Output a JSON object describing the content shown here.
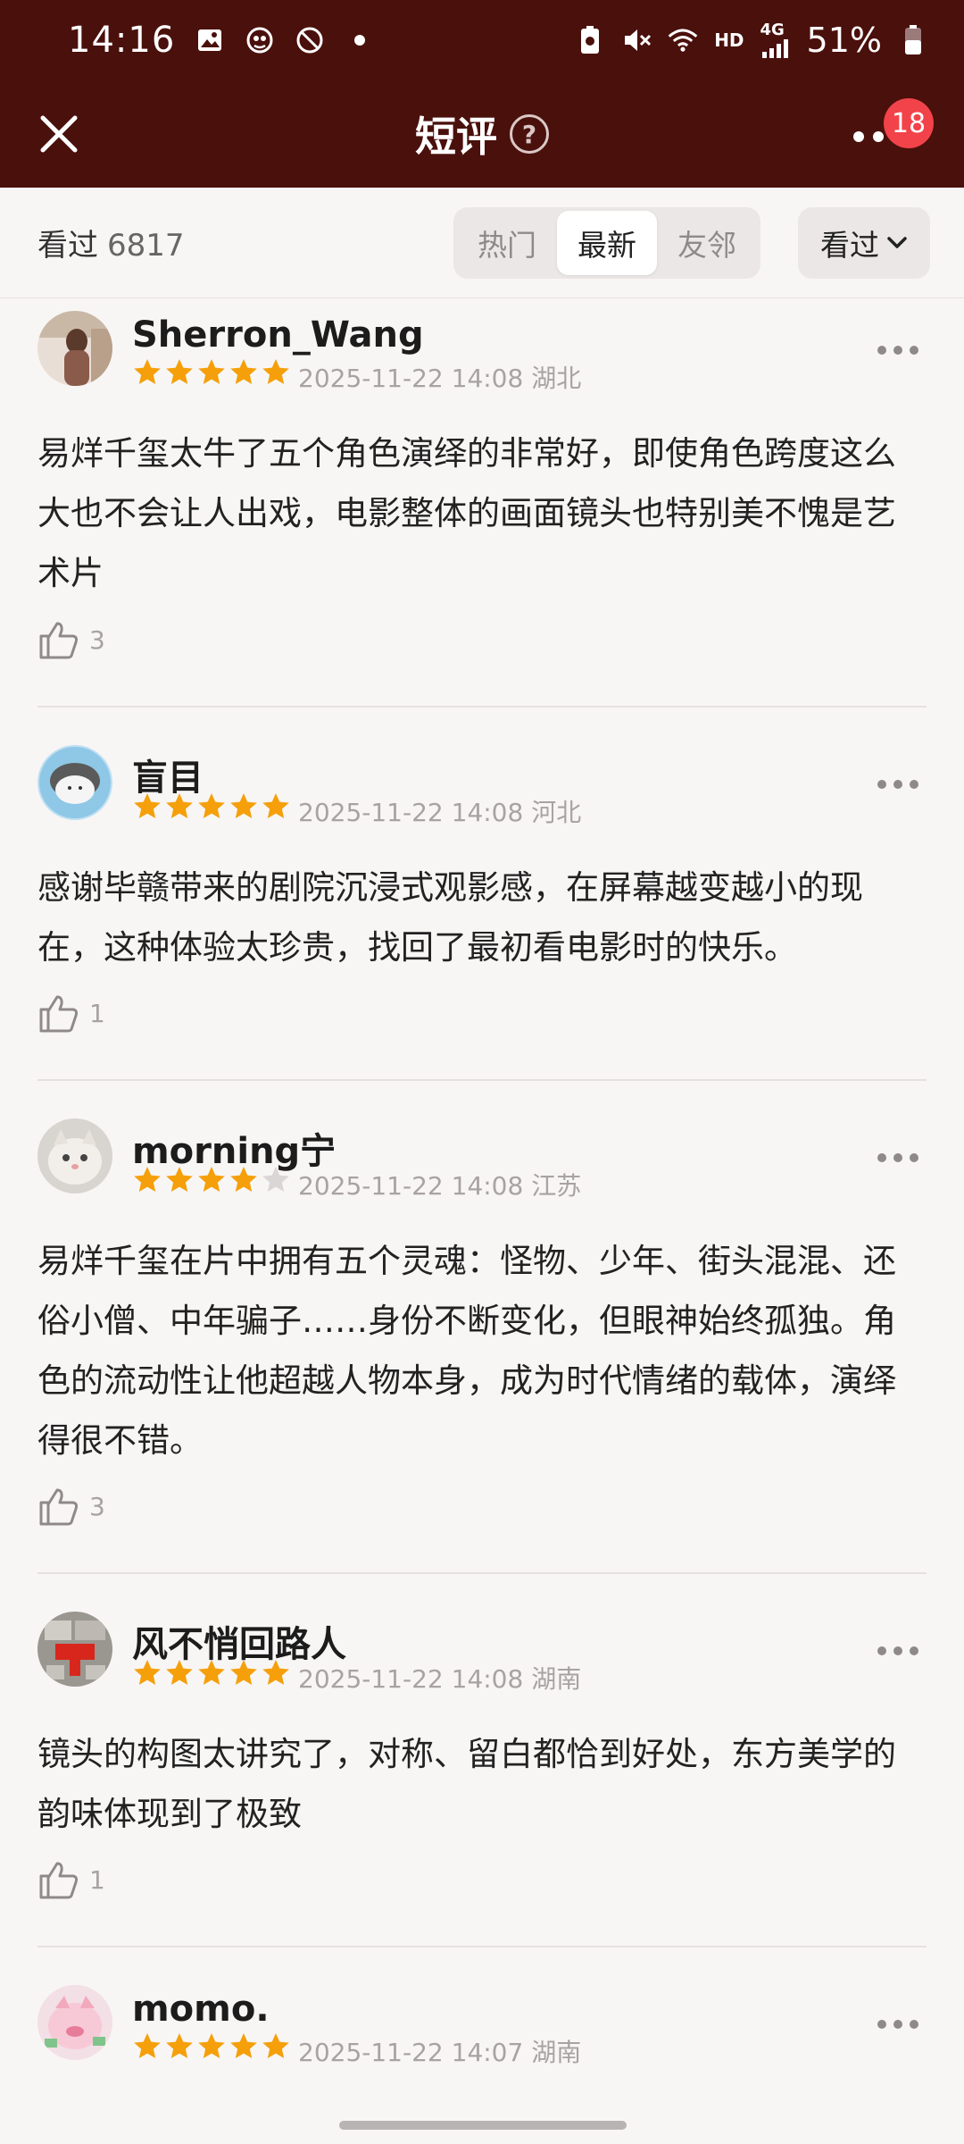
{
  "status_bar": {
    "time": "14:16",
    "network": "HD",
    "signal": "4G",
    "battery": "51%"
  },
  "header": {
    "title": "短评",
    "help": "?",
    "badge": "18",
    "icons": [
      "close-icon",
      "help-icon",
      "more-icon"
    ]
  },
  "filter": {
    "watched_label": "看过",
    "watched_count": "6817",
    "tabs": [
      {
        "label": "热门",
        "active": false
      },
      {
        "label": "最新",
        "active": true
      },
      {
        "label": "友邻",
        "active": false
      }
    ],
    "dropdown_label": "看过"
  },
  "reviews": [
    {
      "user": "Sherron_Wang",
      "stars": 5,
      "date": "2025-11-22 14:08",
      "location": "湖北",
      "text": "易烊千玺太牛了五个角色演绎的非常好，即使角色跨度这么大也不会让人出戏，电影整体的画面镜头也特别美不愧是艺术片",
      "likes": "3"
    },
    {
      "user": "盲目",
      "stars": 5,
      "date": "2025-11-22 14:08",
      "location": "河北",
      "text": "感谢毕赣带来的剧院沉浸式观影感，在屏幕越变越小的现在，这种体验太珍贵，找回了最初看电影时的快乐。",
      "likes": "1"
    },
    {
      "user": "morning宁",
      "stars": 4,
      "date": "2025-11-22 14:08",
      "location": "江苏",
      "text": "易烊千玺在片中拥有五个灵魂：怪物、少年、街头混混、还俗小僧、中年骗子……身份不断变化，但眼神始终孤独。角色的流动性让他超越人物本身，成为时代情绪的载体，演绎得很不错。",
      "likes": "3"
    },
    {
      "user": "风不悄回路人",
      "stars": 5,
      "date": "2025-11-22 14:08",
      "location": "湖南",
      "text": "镜头的构图太讲究了，对称、留白都恰到好处，东方美学的韵味体现到了极致",
      "likes": "1"
    },
    {
      "user": "momo.",
      "stars": 5,
      "date": "2025-11-22 14:07",
      "location": "湖南",
      "text": "",
      "likes": ""
    }
  ],
  "colors": {
    "header_bg": "#4a100c",
    "star": "#f5a00a",
    "star_empty": "#d9d6d5",
    "badge": "#f2434a"
  }
}
